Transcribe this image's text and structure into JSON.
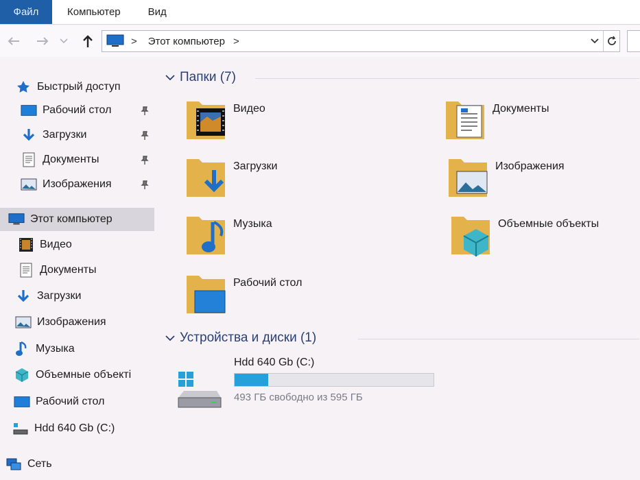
{
  "ribbon": {
    "tabs": [
      "Файл",
      "Компьютер",
      "Вид"
    ]
  },
  "address": {
    "path": [
      "Этот компьютер"
    ]
  },
  "sidebar": {
    "quick_access": {
      "label": "Быстрый доступ",
      "items": [
        {
          "label": "Рабочий стол",
          "icon": "desktop-icon",
          "pinned": true
        },
        {
          "label": "Загрузки",
          "icon": "download-icon",
          "pinned": true
        },
        {
          "label": "Документы",
          "icon": "document-icon",
          "pinned": true
        },
        {
          "label": "Изображения",
          "icon": "pictures-icon",
          "pinned": true
        }
      ]
    },
    "this_pc": {
      "label": "Этот компьютер",
      "items": [
        {
          "label": "Видео",
          "icon": "video-icon"
        },
        {
          "label": "Документы",
          "icon": "document-icon"
        },
        {
          "label": "Загрузки",
          "icon": "download-icon"
        },
        {
          "label": "Изображения",
          "icon": "pictures-icon"
        },
        {
          "label": "Музыка",
          "icon": "music-icon"
        },
        {
          "label": "Объемные объекті",
          "icon": "3d-objects-icon"
        },
        {
          "label": "Рабочий стол",
          "icon": "desktop-icon"
        },
        {
          "label": "Hdd 640 Gb (C:)",
          "icon": "drive-icon"
        }
      ]
    },
    "network": {
      "label": "Сеть",
      "icon": "network-icon"
    }
  },
  "content": {
    "folders_group": {
      "title": "Папки (7)",
      "items": [
        {
          "label": "Видео",
          "icon": "video-folder-icon"
        },
        {
          "label": "Документы",
          "icon": "documents-folder-icon"
        },
        {
          "label": "Загрузки",
          "icon": "downloads-folder-icon"
        },
        {
          "label": "Изображения",
          "icon": "pictures-folder-icon"
        },
        {
          "label": "Музыка",
          "icon": "music-folder-icon"
        },
        {
          "label": "Объемные объекты",
          "icon": "3d-objects-folder-icon"
        },
        {
          "label": "Рабочий стол",
          "icon": "desktop-folder-icon"
        }
      ]
    },
    "devices_group": {
      "title": "Устройства и диски (1)",
      "drive": {
        "name": "Hdd 640 Gb (C:)",
        "free_text": "493 ГБ свободно из 595 ГБ",
        "used_fraction": 0.17,
        "bar_color": "#26a0da"
      }
    }
  }
}
